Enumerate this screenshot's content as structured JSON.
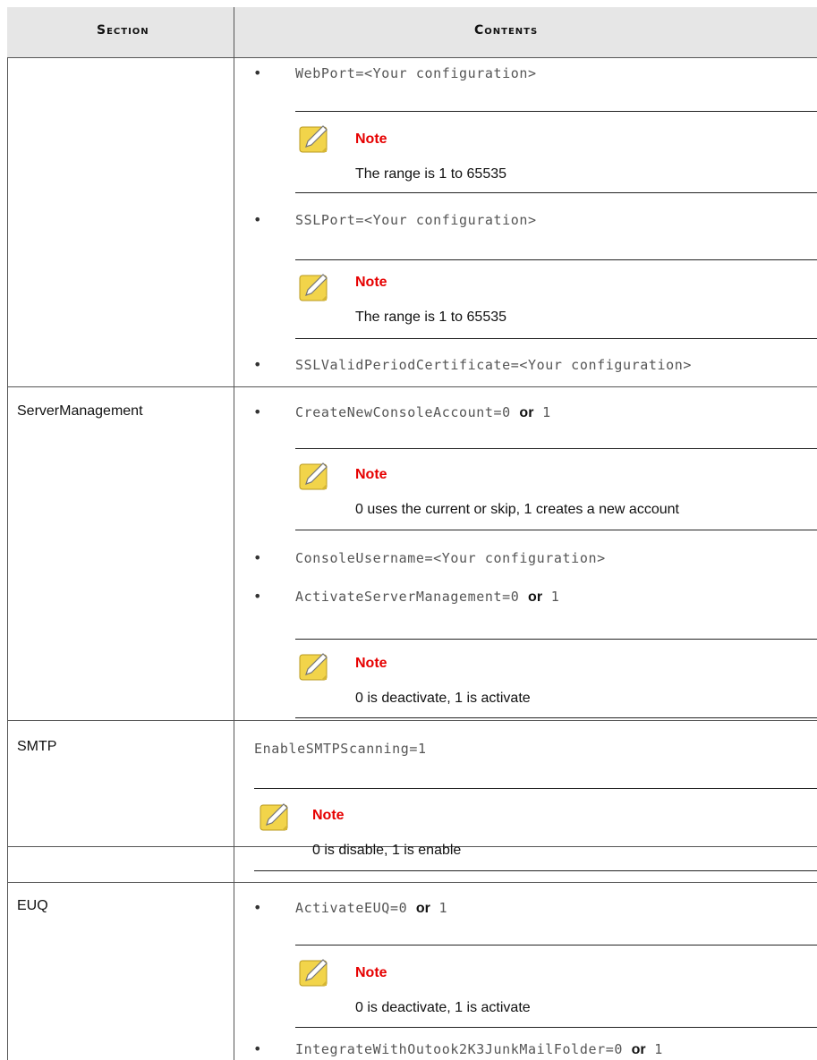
{
  "header": {
    "section": "Section",
    "contents": "Contents"
  },
  "rows": {
    "r1": {
      "section": "",
      "item1": "WebPort=<Your configuration>",
      "note1_title": "Note",
      "note1_text": "The range is 1 to 65535",
      "item2": "SSLPort=<Your configuration>",
      "note2_title": "Note",
      "note2_text": "The range is 1 to 65535",
      "item3": "SSLValidPeriodCertificate=<Your configuration>"
    },
    "r2": {
      "section": "ServerManagement",
      "item1_code": "CreateNewConsoleAccount=0",
      "item1_or": "or",
      "item1_val": "1",
      "note1_title": "Note",
      "note1_text": "0 uses the current or skip, 1 creates a new account",
      "item2": "ConsoleUsername=<Your configuration>",
      "item3_code": "ActivateServerManagement=0",
      "item3_or": "or",
      "item3_val": "1",
      "note2_title": "Note",
      "note2_text": "0 is deactivate, 1 is activate"
    },
    "r3": {
      "section": "SMTP",
      "item1": "EnableSMTPScanning=1",
      "note1_title": "Note",
      "note1_text": "0 is disable, 1 is enable"
    },
    "r4": {
      "section": "EUQ",
      "item1_code": "ActivateEUQ=0",
      "item1_or": "or",
      "item1_val": "1",
      "note1_title": "Note",
      "note1_text": "0 is deactivate, 1 is activate",
      "item2_code": "IntegrateWithOutook2K3JunkMailFolder=0",
      "item2_or": "or",
      "item2_val": "1"
    }
  },
  "icons": {
    "note": "note-pencil-icon",
    "note_color": "#f2d44a"
  }
}
